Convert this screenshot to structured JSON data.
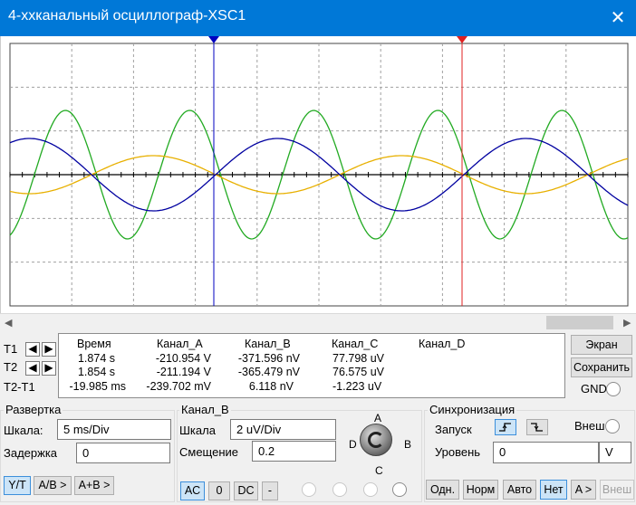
{
  "window": {
    "title": "4-ххканальный осциллограф-XSC1",
    "close_glyph": "✕"
  },
  "colors": {
    "accent": "#0078d7",
    "ch_a": "#0000a0",
    "ch_b": "#22aa22",
    "ch_c": "#e8b000",
    "cursor1": "#0000c0",
    "cursor2": "#e02020"
  },
  "cursors": {
    "t1": "T1",
    "t2": "T2",
    "diff": "T2-T1"
  },
  "readout": {
    "headers": [
      "Время",
      "Канал_A",
      "Канал_B",
      "Канал_C",
      "Канал_D"
    ],
    "rows": [
      [
        "1.874 s",
        "-210.954 V",
        "-371.596 nV",
        "77.798 uV",
        ""
      ],
      [
        "1.854 s",
        "-211.194 V",
        "-365.479 nV",
        "76.575 uV",
        ""
      ],
      [
        "-19.985 ms",
        "-239.702 mV",
        "6.118 nV",
        "-1.223 uV",
        ""
      ]
    ]
  },
  "side_buttons": {
    "screen": "Экран",
    "save": "Сохранить",
    "gnd": "GND"
  },
  "sweep": {
    "title": "Развертка",
    "scale_label": "Шкала:",
    "scale_value": "5 ms/Div",
    "delay_label": "Задержка",
    "delay_value": "0",
    "modes": [
      "Y/T",
      "A/B >",
      "A+B >"
    ]
  },
  "channel": {
    "title": "Канал_B",
    "scale_label": "Шкала",
    "scale_value": "2 uV/Div",
    "offset_label": "Смещение",
    "offset_value": "0.2",
    "knob_labels": {
      "a": "A",
      "b": "B",
      "c": "C",
      "d": "D"
    },
    "coupling": [
      "AC",
      "0",
      "DC",
      "-"
    ]
  },
  "trigger": {
    "title": "Синхронизация",
    "start_label": "Запуск",
    "rising_icon": "rising-edge-icon",
    "falling_icon": "falling-edge-icon",
    "ext_label": "Внеш",
    "level_label": "Уровень",
    "level_value": "0",
    "level_unit": "V",
    "modes": [
      "Одн.",
      "Норм",
      "Авто",
      "Нет",
      "A >",
      "Внеш"
    ]
  },
  "icons": {
    "left": "◀",
    "right": "▶"
  }
}
